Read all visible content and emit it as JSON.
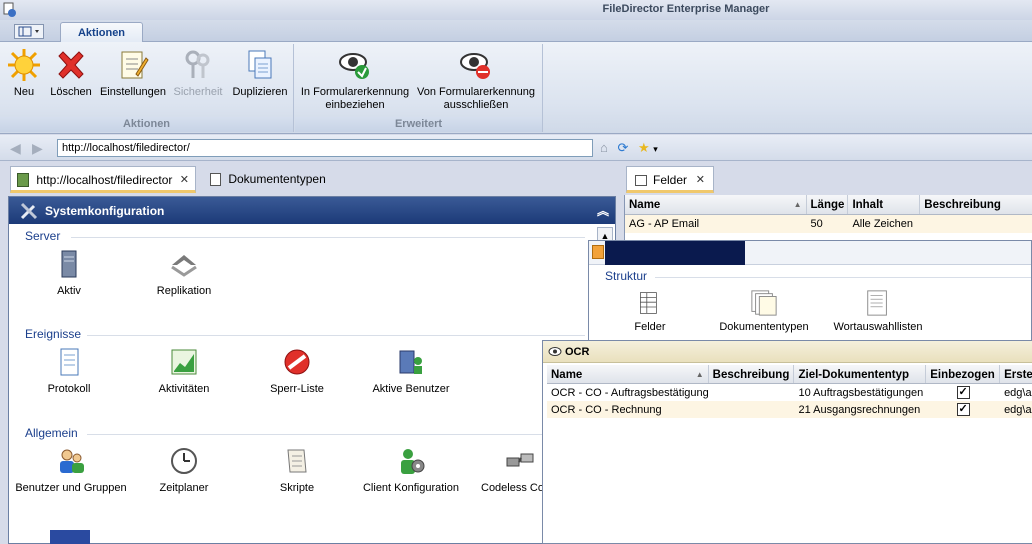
{
  "window": {
    "title": "FileDirector Enterprise Manager"
  },
  "ribbon": {
    "tab": "Aktionen",
    "groups": [
      {
        "label": "Aktionen",
        "buttons": [
          "Neu",
          "Löschen",
          "Einstellungen",
          "Sicherheit",
          "Duplizieren"
        ]
      },
      {
        "label": "Erweitert",
        "buttons": [
          "In Formularerkennung\neinbeziehen",
          "Von Formularerkennung\nausschließen"
        ]
      }
    ]
  },
  "address": {
    "url": "http://localhost/filedirector/"
  },
  "doc_tabs": {
    "active": "http://localhost/filedirector",
    "other": "Dokumententypen"
  },
  "system": {
    "header": "Systemkonfiguration",
    "sections": {
      "server": {
        "title": "Server",
        "items": [
          "Aktiv",
          "Replikation"
        ]
      },
      "ereignisse": {
        "title": "Ereignisse",
        "items": [
          "Protokoll",
          "Aktivitäten",
          "Sperr-Liste",
          "Aktive Benutzer"
        ]
      },
      "allgemein": {
        "title": "Allgemein",
        "items": [
          "Benutzer und Gruppen",
          "Zeitplaner",
          "Skripte",
          "Client Konfiguration",
          "Codeless Con"
        ]
      }
    }
  },
  "felder": {
    "tab": "Felder",
    "columns": [
      "Name",
      "Länge",
      "Inhalt",
      "Beschreibung"
    ],
    "rows": [
      {
        "name": "AG - AP Email",
        "laenge": "50",
        "inhalt": "Alle Zeichen",
        "beschreibung": ""
      }
    ]
  },
  "struktur": {
    "section": "Struktur",
    "items": [
      "Felder",
      "Dokumententypen",
      "Wortauswahllisten"
    ]
  },
  "ocr": {
    "title": "OCR",
    "columns": [
      "Name",
      "Beschreibung",
      "Ziel-Dokumententyp",
      "Einbezogen",
      "Erste"
    ],
    "rows": [
      {
        "name": "OCR - CO - Auftragsbestätigung",
        "beschreibung": "",
        "ziel": "10 Auftragsbestätigungen",
        "einbezogen": "✓",
        "ersteller": "edg\\ac"
      },
      {
        "name": "OCR - CO - Rechnung",
        "beschreibung": "",
        "ziel": "21 Ausgangsrechnungen",
        "einbezogen": "✓",
        "ersteller": "edg\\ac"
      }
    ]
  }
}
